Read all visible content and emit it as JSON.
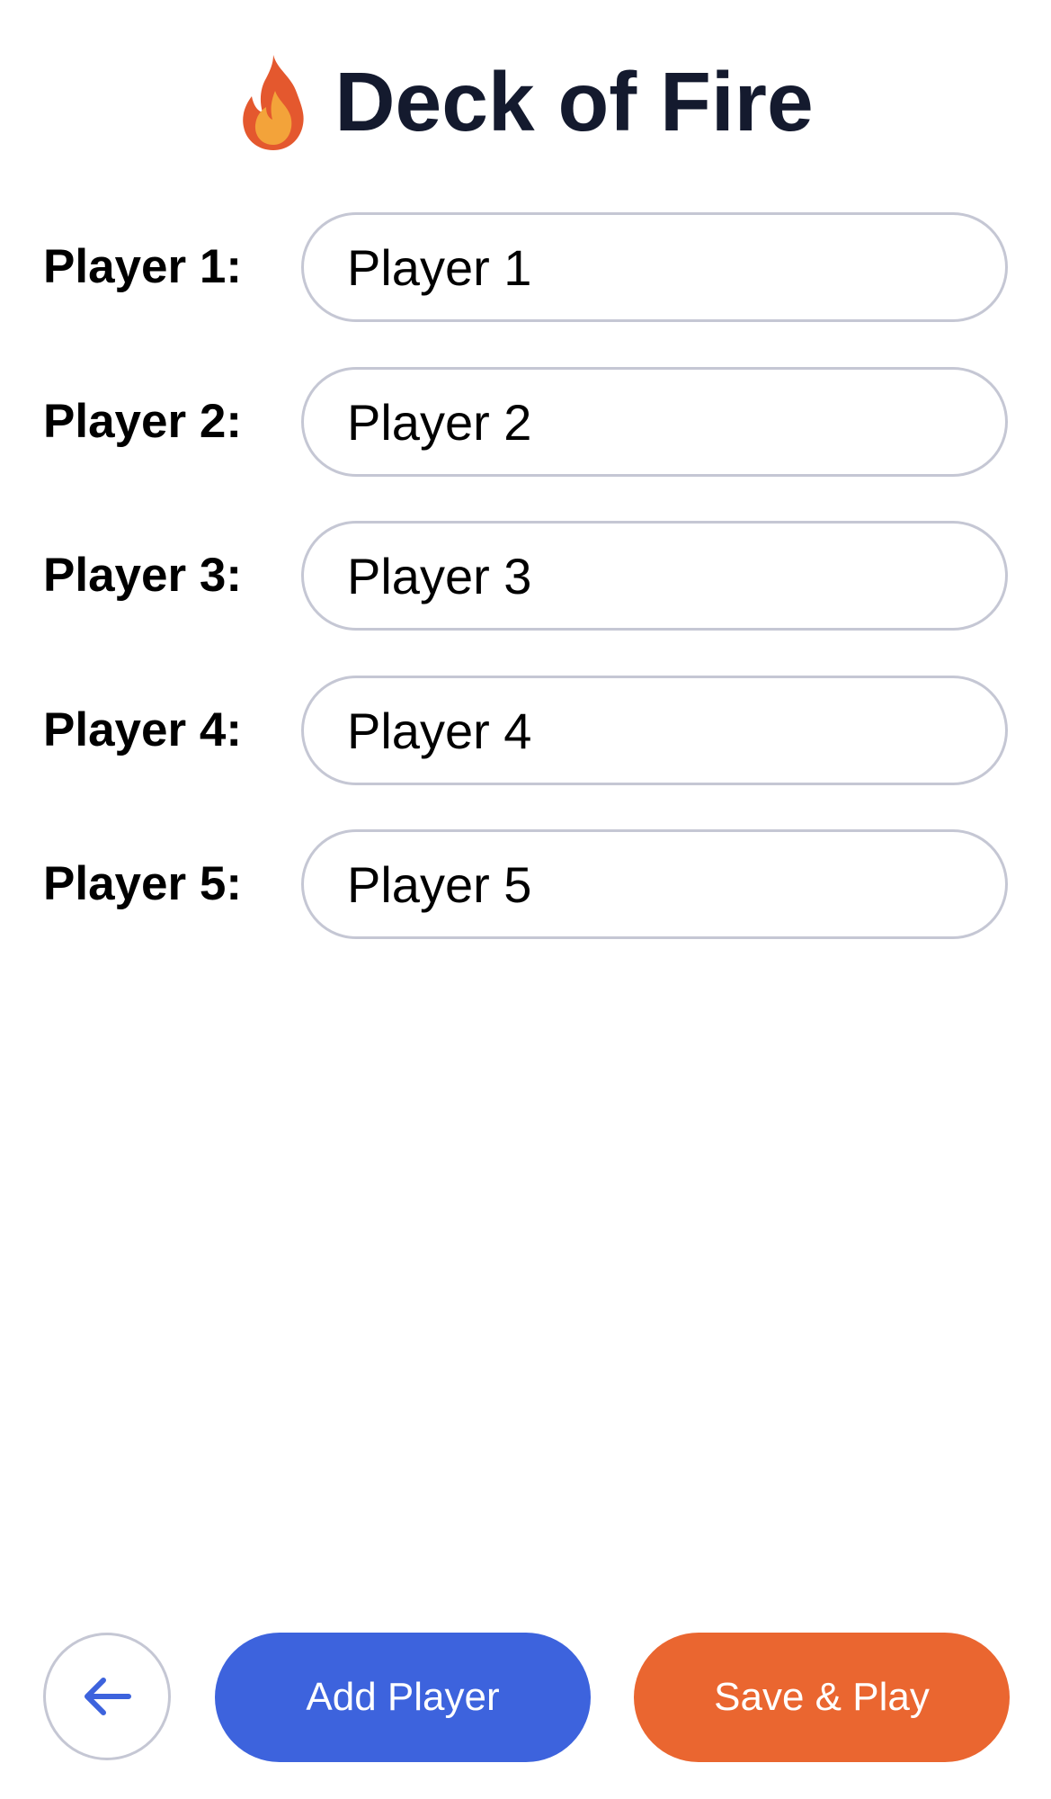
{
  "app": {
    "title": "Deck of Fire",
    "title_icon": "fire-icon"
  },
  "players": [
    {
      "label": "Player 1:",
      "value": "Player 1"
    },
    {
      "label": "Player 2:",
      "value": "Player 2"
    },
    {
      "label": "Player 3:",
      "value": "Player 3"
    },
    {
      "label": "Player 4:",
      "value": "Player 4"
    },
    {
      "label": "Player 5:",
      "value": "Player 5"
    }
  ],
  "footer": {
    "back_icon": "arrow-left-icon",
    "add_label": "Add Player",
    "save_label": "Save & Play"
  },
  "colors": {
    "title": "#141a2e",
    "add_button": "#3d63dd",
    "save_button": "#ea6630",
    "input_border": "#c5c7d4",
    "back_arrow": "#3d63dd"
  }
}
